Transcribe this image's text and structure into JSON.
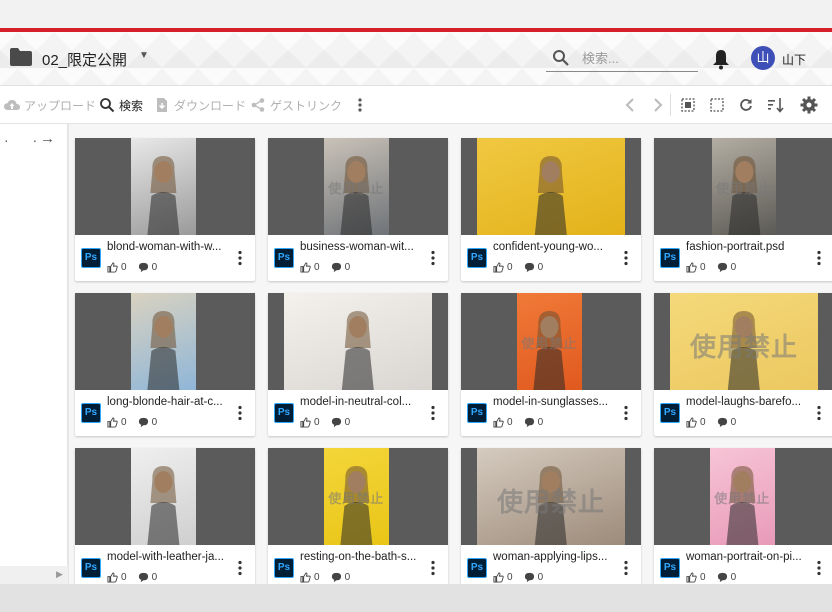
{
  "header": {
    "folder_name": "02_限定公開",
    "search_placeholder": "検索...",
    "avatar_initial": "山",
    "user_name": "山下"
  },
  "toolbar": {
    "upload_label": "アップロード",
    "search_label": "検索",
    "download_label": "ダウンロード",
    "guestlink_label": "ゲストリンク"
  },
  "sidepanel": {
    "dots": "· ·",
    "arrow": "→"
  },
  "watermark_text": "使用禁止",
  "assets": [
    {
      "name": "blond-woman-with-w...",
      "likes": "0",
      "comments": "0",
      "colors": [
        "#9a9a9a",
        "#e8e8e8"
      ],
      "watermark": false,
      "photo_span": [
        0.31,
        0.67
      ]
    },
    {
      "name": "business-woman-wit...",
      "likes": "0",
      "comments": "0",
      "colors": [
        "#6f7378",
        "#c9c2b8"
      ],
      "watermark": true,
      "photo_span": [
        0.31,
        0.67
      ]
    },
    {
      "name": "confident-young-wo...",
      "likes": "0",
      "comments": "0",
      "colors": [
        "#e3b21a",
        "#f0c841"
      ],
      "watermark": false,
      "photo_span": [
        0.09,
        0.91
      ]
    },
    {
      "name": "fashion-portrait.psd",
      "likes": "0",
      "comments": "0",
      "colors": [
        "#5c5a55",
        "#b3aea3"
      ],
      "watermark": true,
      "photo_span": [
        0.32,
        0.68
      ]
    },
    {
      "name": "long-blonde-hair-at-c...",
      "likes": "0",
      "comments": "0",
      "colors": [
        "#8fb6d8",
        "#d9d2c0"
      ],
      "watermark": false,
      "photo_span": [
        0.31,
        0.67
      ]
    },
    {
      "name": "model-in-neutral-col...",
      "likes": "0",
      "comments": "0",
      "colors": [
        "#d9d6d2",
        "#f4f1ec"
      ],
      "watermark": false,
      "photo_span": [
        0.09,
        0.91
      ]
    },
    {
      "name": "model-in-sunglasses...",
      "likes": "0",
      "comments": "0",
      "colors": [
        "#e0591e",
        "#f07a38"
      ],
      "watermark": true,
      "photo_span": [
        0.31,
        0.67
      ]
    },
    {
      "name": "model-laughs-barefo...",
      "likes": "0",
      "comments": "0",
      "colors": [
        "#ecc860",
        "#f4d97a"
      ],
      "watermark": true,
      "photo_span": [
        0.09,
        0.91
      ]
    },
    {
      "name": "model-with-leather-ja...",
      "likes": "0",
      "comments": "0",
      "colors": [
        "#cfcfcf",
        "#efefef"
      ],
      "watermark": false,
      "photo_span": [
        0.31,
        0.67
      ]
    },
    {
      "name": "resting-on-the-bath-s...",
      "likes": "0",
      "comments": "0",
      "colors": [
        "#e8c516",
        "#f4d63a"
      ],
      "watermark": true,
      "photo_span": [
        0.31,
        0.67
      ]
    },
    {
      "name": "woman-applying-lips...",
      "likes": "0",
      "comments": "0",
      "colors": [
        "#9d8b7a",
        "#d5cbbf"
      ],
      "watermark": true,
      "photo_span": [
        0.09,
        0.91
      ]
    },
    {
      "name": "woman-portrait-on-pi...",
      "likes": "0",
      "comments": "0",
      "colors": [
        "#e89ab8",
        "#f7c4d6"
      ],
      "watermark": true,
      "photo_span": [
        0.31,
        0.67
      ]
    }
  ],
  "colors": {
    "accent_red": "#d6202a",
    "avatar_blue": "#3e4fb8",
    "ps_dark": "#001e36",
    "ps_blue": "#31a8ff"
  }
}
